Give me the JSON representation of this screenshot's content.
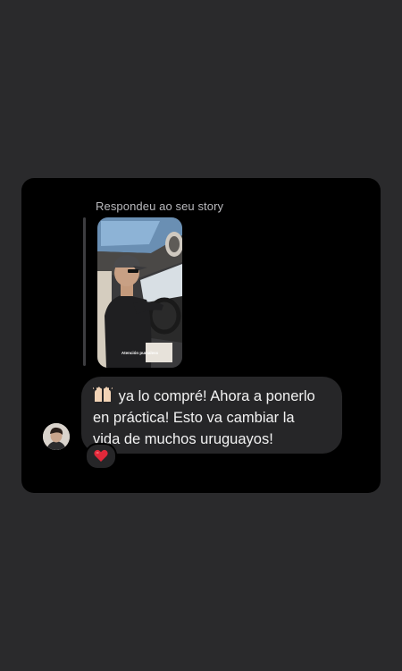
{
  "message": {
    "reply_context": "Respondeu ao seu story",
    "story": {
      "caption": "Atención pumaless"
    },
    "text_line1_after_emoji": " ya lo compré! Ahora a ponerlo",
    "text_line2": "en práctica! Esto va cambiar la",
    "text_line3": "vida de muchos uruguayos!",
    "reaction": "heart-icon"
  },
  "colors": {
    "page_bg": "#2a2a2c",
    "card_bg": "#000000",
    "bubble_bg": "#262628",
    "text": "#f2f2f2",
    "muted": "#b9b9bd",
    "heart": "#e0293a"
  }
}
